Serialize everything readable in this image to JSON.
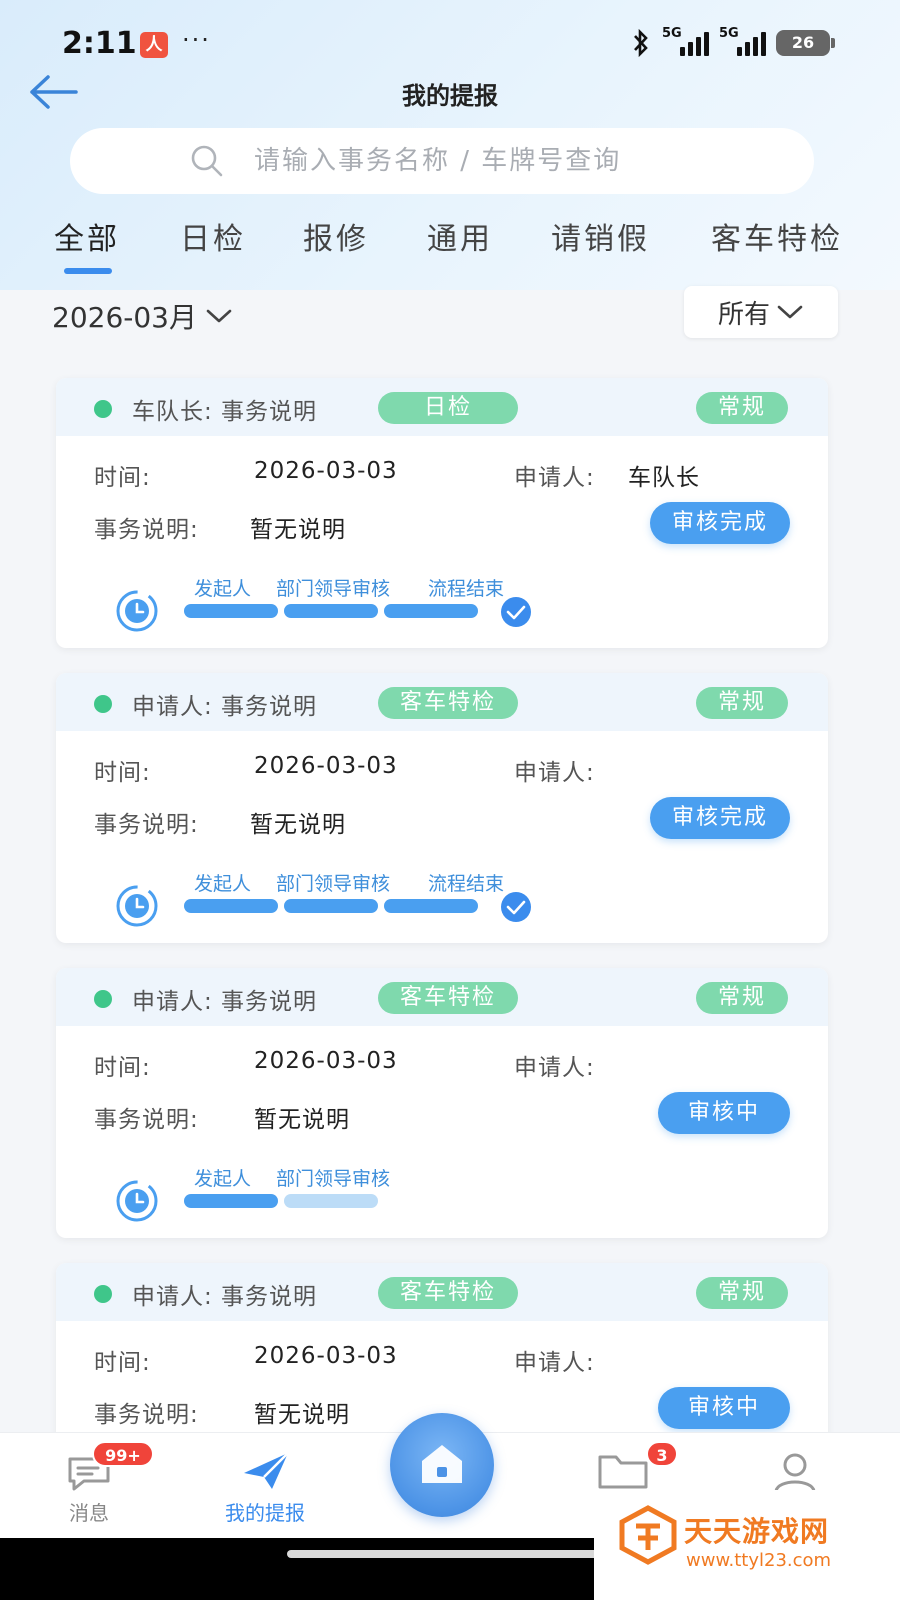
{
  "status_bar": {
    "time": "2:11",
    "app_icon_glyph": "人",
    "more": "···",
    "network1": "5G",
    "network2": "5G",
    "battery": "26"
  },
  "header": {
    "title": "我的提报"
  },
  "search": {
    "placeholder": "请输入事务名称 / 车牌号查询"
  },
  "tabs": [
    {
      "label": "全部",
      "active": true
    },
    {
      "label": "日检",
      "active": false
    },
    {
      "label": "报修",
      "active": false
    },
    {
      "label": "通用",
      "active": false
    },
    {
      "label": "请销假",
      "active": false
    },
    {
      "label": "客车特检",
      "active": false
    }
  ],
  "filters": {
    "month": "2026-03月",
    "scope": "所有"
  },
  "field_labels": {
    "time": "时间:",
    "applicant": "申请人:",
    "description": "事务说明:"
  },
  "cards": [
    {
      "title": "车队长: 事务说明",
      "type_tag": "日检",
      "priority": "常规",
      "time": "2026-03-03",
      "applicant": "车队长",
      "description": "暂无说明",
      "status": "审核完成",
      "steps": [
        "发起人",
        "部门领导审核",
        "流程结束"
      ],
      "completed": true
    },
    {
      "title": "申请人: 事务说明",
      "type_tag": "客车特检",
      "priority": "常规",
      "time": "2026-03-03",
      "applicant": "",
      "description": "暂无说明",
      "status": "审核完成",
      "steps": [
        "发起人",
        "部门领导审核",
        "流程结束"
      ],
      "completed": true
    },
    {
      "title": "申请人: 事务说明",
      "type_tag": "客车特检",
      "priority": "常规",
      "time": "2026-03-03",
      "applicant": "",
      "description": "暂无说明",
      "status": "审核中",
      "steps": [
        "发起人",
        "部门领导审核"
      ],
      "completed": false
    },
    {
      "title": "申请人: 事务说明",
      "type_tag": "客车特检",
      "priority": "常规",
      "time": "2026-03-03",
      "applicant": "",
      "description": "暂无说明",
      "status": "审核中",
      "steps": [],
      "completed": false
    }
  ],
  "bottom_nav": {
    "messages": {
      "label": "消息",
      "badge": "99+",
      "icon": "chat-bubble-icon"
    },
    "my_reports": {
      "label": "我的提报",
      "icon": "paper-plane-icon",
      "active": true
    },
    "home": {
      "icon": "home-icon"
    },
    "files": {
      "badge": "3",
      "icon": "folder-icon"
    },
    "profile": {
      "icon": "user-icon"
    }
  },
  "watermark": {
    "name": "天天游戏网",
    "url": "www.ttyl23.com"
  },
  "colors": {
    "accent": "#3b8ced",
    "tag_green": "#7fd9ad",
    "status_dot": "#3fc68a",
    "badge_red": "#f0443a"
  }
}
